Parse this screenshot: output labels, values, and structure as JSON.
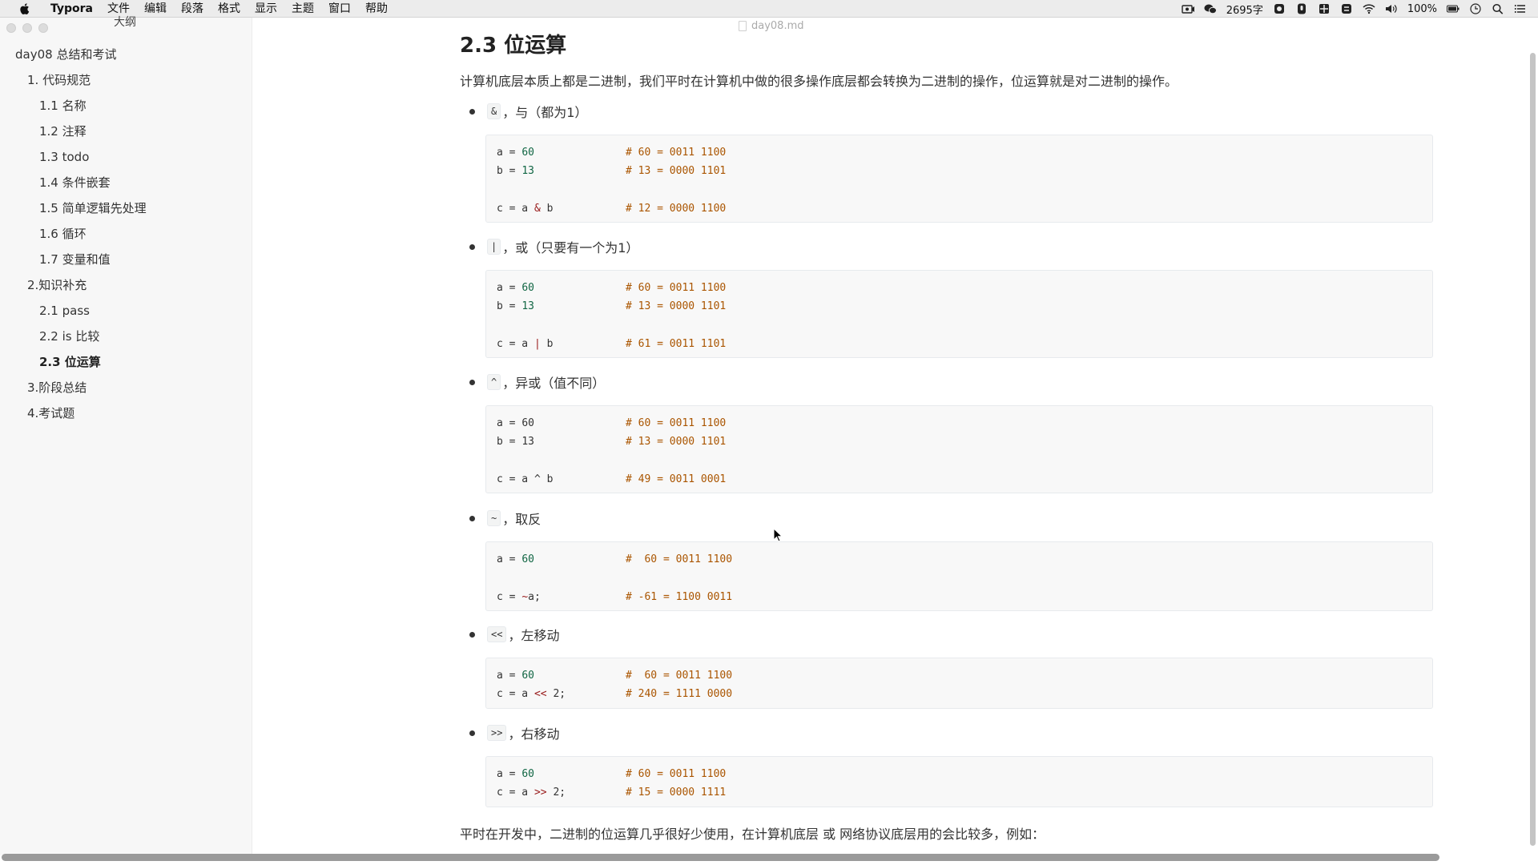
{
  "menubar": {
    "app_name": "Typora",
    "items": [
      "文件",
      "编辑",
      "段落",
      "格式",
      "显示",
      "主题",
      "窗口",
      "帮助"
    ],
    "word_count": "2695字",
    "battery": "100%"
  },
  "window": {
    "doc_title": "day08.md"
  },
  "sidebar": {
    "title": "大纲",
    "items": [
      {
        "label": "day08 总结和考试"
      },
      {
        "label": "1. 代码规范"
      },
      {
        "label": "1.1 名称"
      },
      {
        "label": "1.2 注释"
      },
      {
        "label": "1.3 todo"
      },
      {
        "label": "1.4 条件嵌套"
      },
      {
        "label": "1.5 简单逻辑先处理"
      },
      {
        "label": "1.6 循环"
      },
      {
        "label": "1.7 变量和值"
      },
      {
        "label": "2.知识补充"
      },
      {
        "label": "2.1 pass"
      },
      {
        "label": "2.2 is 比较"
      },
      {
        "label": "2.3 位运算"
      },
      {
        "label": "3.阶段总结"
      },
      {
        "label": "4.考试题"
      }
    ]
  },
  "content": {
    "heading": "2.3 位运算",
    "intro": "计算机底层本质上都是二进制，我们平时在计算机中做的很多操作底层都会转换为二进制的操作，位运算就是对二进制的操作。",
    "sections": [
      {
        "code": "&",
        "desc": "，与（都为1）",
        "lines": [
          {
            "a": "a = ",
            "n": "60",
            "b": "",
            "comment": "# 60 = 0011 1100"
          },
          {
            "a": "b = ",
            "n": "13",
            "b": "",
            "comment": "# 13 = 0000 1101"
          },
          {
            "a": "",
            "n": "",
            "b": "",
            "comment": ""
          },
          {
            "a": "c = a ",
            "n": "&",
            "b": " b",
            "comment": "# 12 = 0000 1100"
          }
        ]
      },
      {
        "code": "|",
        "desc": "，或（只要有一个为1）",
        "lines": [
          {
            "a": "a = ",
            "n": "60",
            "b": "",
            "comment": "# 60 = 0011 1100"
          },
          {
            "a": "b = ",
            "n": "13",
            "b": "",
            "comment": "# 13 = 0000 1101"
          },
          {
            "a": "",
            "n": "",
            "b": "",
            "comment": ""
          },
          {
            "a": "c = a ",
            "n": "|",
            "b": " b",
            "comment": "# 61 = 0011 1101"
          }
        ]
      },
      {
        "code": "^",
        "desc": "，异或（值不同）",
        "lines": [
          {
            "a": "a = ",
            "n": "60",
            "b": "",
            "comment": "# 60 = 0011 1100"
          },
          {
            "a": "b = ",
            "n": "13",
            "b": "",
            "comment": "# 13 = 0000 1101"
          },
          {
            "a": "",
            "n": "",
            "b": "",
            "comment": ""
          },
          {
            "a": "c = a ",
            "n": "^",
            "b": " b",
            "comment": "# 49 = 0011 0001"
          }
        ]
      },
      {
        "code": "~",
        "desc": "，取反",
        "lines": [
          {
            "a": "a = ",
            "n": "60",
            "b": "",
            "comment": "#  60 = 0011 1100"
          },
          {
            "a": "",
            "n": "",
            "b": "",
            "comment": ""
          },
          {
            "a": "c = ",
            "n": "~",
            "b": "a;",
            "comment": "# -61 = 1100 0011"
          }
        ]
      },
      {
        "code": "<<",
        "desc": "，左移动",
        "lines": [
          {
            "a": "a = ",
            "n": "60",
            "b": "",
            "comment": "#  60 = 0011 1100"
          },
          {
            "a": "c = a ",
            "n": "<<",
            "b": " 2;",
            "comment": "# 240 = 1111 0000"
          }
        ]
      },
      {
        "code": ">>",
        "desc": "，右移动",
        "lines": [
          {
            "a": "a = ",
            "n": "60",
            "b": "",
            "comment": "# 60 = 0011 1100"
          },
          {
            "a": "c = a ",
            "n": ">>",
            "b": " 2;",
            "comment": "# 15 = 0000 1111"
          }
        ]
      }
    ],
    "footer": "平时在开发中，二进制的位运算几乎很好少使用，在计算机底层 或 网络协议底层用的会比较多，例如："
  }
}
